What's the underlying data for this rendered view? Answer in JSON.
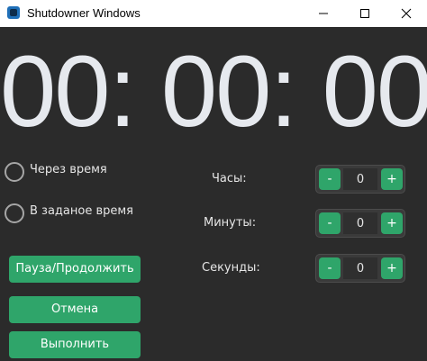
{
  "window": {
    "title": "Shutdowner Windows",
    "icon": "app-icon",
    "accent_color": "#2fa56a"
  },
  "timer": {
    "display": "00: 00: 00"
  },
  "modes": [
    {
      "label": "Через время",
      "selected": false
    },
    {
      "label": "В заданое время",
      "selected": false
    }
  ],
  "spinners": {
    "hours": {
      "label": "Часы:",
      "value": "0",
      "minus": "-",
      "plus": "+"
    },
    "minutes": {
      "label": "Минуты:",
      "value": "0",
      "minus": "-",
      "plus": "+"
    },
    "seconds": {
      "label": "Секунды:",
      "value": "0",
      "minus": "-",
      "plus": "+"
    }
  },
  "actions": {
    "pause": "Пауза/Продолжить",
    "cancel": "Отмена",
    "run": "Выполнить"
  }
}
